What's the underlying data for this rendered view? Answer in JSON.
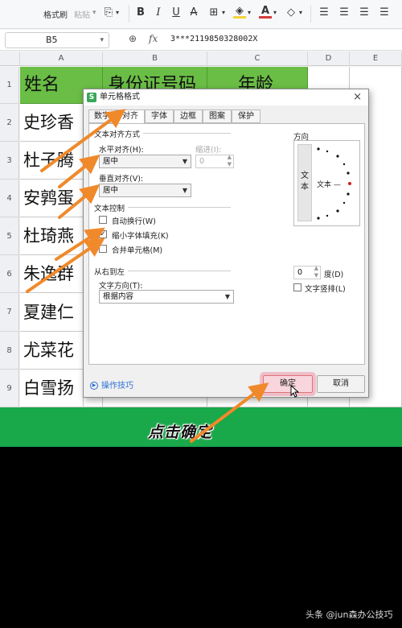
{
  "toolbar": {
    "format_painter": "格式刷",
    "paste": "粘贴",
    "bold": "B",
    "italic": "I",
    "underline": "U",
    "strikethrough": "A"
  },
  "formula_bar": {
    "cell_ref": "B5",
    "formula_value": "3***2119850328002X"
  },
  "columns": [
    "A",
    "B",
    "C",
    "D",
    "E"
  ],
  "rows": [
    "1",
    "2",
    "3",
    "4",
    "5",
    "6",
    "7",
    "8",
    "9"
  ],
  "sheet": {
    "header_name": "姓名",
    "header_id": "身份证号码",
    "header_age": "年龄",
    "names": [
      "史珍香",
      "杜子腾",
      "安鹑蛋",
      "杜琦燕",
      "朱逸群",
      "夏建仁",
      "尤菜花",
      "白雪扬"
    ]
  },
  "dialog": {
    "title": "单元格格式",
    "close": "×",
    "tabs": [
      "数字",
      "对齐",
      "字体",
      "边框",
      "图案",
      "保护"
    ],
    "active_tab": "对齐",
    "text_align_section": "文本对齐方式",
    "horizontal_label": "水平对齐(H):",
    "horizontal_value": "居中",
    "indent_label": "缩进(I):",
    "indent_value": "0",
    "vertical_label": "垂直对齐(V):",
    "vertical_value": "居中",
    "text_control_section": "文本控制",
    "wrap_text": "自动换行(W)",
    "wrap_checked": false,
    "shrink_fit": "缩小字体填充(K)",
    "shrink_checked": true,
    "merge_cells": "合并单元格(M)",
    "merge_checked": false,
    "rtl_section": "从右到左",
    "text_direction_label": "文字方向(T):",
    "text_direction_value": "根据内容",
    "orientation_section": "方向",
    "orientation_vertical": "文本",
    "orientation_text": "文本 —",
    "degree_value": "0",
    "degree_unit": "度(D)",
    "stack_text": "文字竖排(L)",
    "tips": "操作技巧",
    "ok": "确定",
    "cancel": "取消"
  },
  "caption": "点击确定",
  "watermark": "头条 @jun森办公技巧",
  "colors": {
    "green_header": "#6abd45",
    "banner": "#19a84a",
    "arrow": "#f0892a"
  }
}
